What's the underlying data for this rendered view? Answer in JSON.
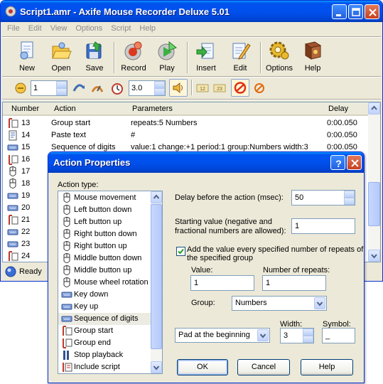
{
  "window": {
    "title": "Script1.amr - Axife Mouse Recorder Deluxe 5.01"
  },
  "menu": [
    "File",
    "Edit",
    "View",
    "Options",
    "Script",
    "Help"
  ],
  "toolbar": {
    "new": "New",
    "open": "Open",
    "save": "Save",
    "record": "Record",
    "play": "Play",
    "insert": "Insert",
    "edit": "Edit",
    "options": "Options",
    "help": "Help"
  },
  "small_toolbar": {
    "repeat_value": "1",
    "speed_value": "3.0"
  },
  "list": {
    "columns": {
      "number": "Number",
      "action": "Action",
      "parameters": "Parameters",
      "delay": "Delay"
    },
    "rows": [
      {
        "number": "13",
        "action": "Group start",
        "parameters": "repeats:5 Numbers",
        "delay": "0:00.050",
        "icon": "group-start"
      },
      {
        "number": "14",
        "action": "Paste text",
        "parameters": "#",
        "delay": "0:00.050",
        "icon": "paste-text"
      },
      {
        "number": "15",
        "action": "Sequence of digits",
        "parameters": "value:1 change:+1 period:1 group:Numbers width:3",
        "delay": "0:00.050",
        "icon": "keyboard"
      },
      {
        "number": "16",
        "action": "",
        "parameters": "",
        "delay": "",
        "icon": "group-end"
      },
      {
        "number": "17",
        "action": "",
        "parameters": "",
        "delay": "",
        "icon": "mouse"
      },
      {
        "number": "18",
        "action": "",
        "parameters": "",
        "delay": "",
        "icon": "mouse"
      },
      {
        "number": "19",
        "action": "",
        "parameters": "",
        "delay": "",
        "icon": "keyboard"
      },
      {
        "number": "20",
        "action": "",
        "parameters": "",
        "delay": "",
        "icon": "keyboard"
      },
      {
        "number": "21",
        "action": "",
        "parameters": "",
        "delay": "",
        "icon": "group-start"
      },
      {
        "number": "22",
        "action": "",
        "parameters": "",
        "delay": "",
        "icon": "keyboard"
      },
      {
        "number": "23",
        "action": "",
        "parameters": "",
        "delay": "",
        "icon": "keyboard"
      },
      {
        "number": "24",
        "action": "",
        "parameters": "",
        "delay": "",
        "icon": "group-start"
      }
    ]
  },
  "status": {
    "text": "Ready"
  },
  "dialog": {
    "title": "Action Properties",
    "action_type_label": "Action type:",
    "action_types": [
      {
        "label": "Mouse movement",
        "icon": "mouse"
      },
      {
        "label": "Left button down",
        "icon": "mouse"
      },
      {
        "label": "Left button up",
        "icon": "mouse"
      },
      {
        "label": "Right button down",
        "icon": "mouse"
      },
      {
        "label": "Right button up",
        "icon": "mouse"
      },
      {
        "label": "Middle button down",
        "icon": "mouse"
      },
      {
        "label": "Middle button up",
        "icon": "mouse"
      },
      {
        "label": "Mouse wheel rotation",
        "icon": "mouse"
      },
      {
        "label": "Key down",
        "icon": "keyboard"
      },
      {
        "label": "Key up",
        "icon": "keyboard"
      },
      {
        "label": "Sequence of digits",
        "icon": "keyboard",
        "selected": true
      },
      {
        "label": "Group start",
        "icon": "group-start"
      },
      {
        "label": "Group end",
        "icon": "group-end"
      },
      {
        "label": "Stop playback",
        "icon": "stop"
      },
      {
        "label": "Include script",
        "icon": "include"
      }
    ],
    "delay_label": "Delay before the action (msec):",
    "delay_value": "50",
    "start_label_1": "Starting value (negative and",
    "start_label_2": "fractional numbers are allowed):",
    "start_value": "1",
    "add_check_label_1": "Add the value every specified number of repeats of",
    "add_check_label_2": "the specified group",
    "add_checked": true,
    "value_label": "Value:",
    "value_value": "1",
    "repeats_label": "Number of repeats:",
    "repeats_value": "1",
    "group_label": "Group:",
    "group_value": "Numbers",
    "width_label": "Width:",
    "symbol_label": "Symbol:",
    "pad_value": "Pad at the beginning",
    "width_value": "3",
    "symbol_value": "_",
    "ok": "OK",
    "cancel": "Cancel",
    "help": "Help"
  }
}
